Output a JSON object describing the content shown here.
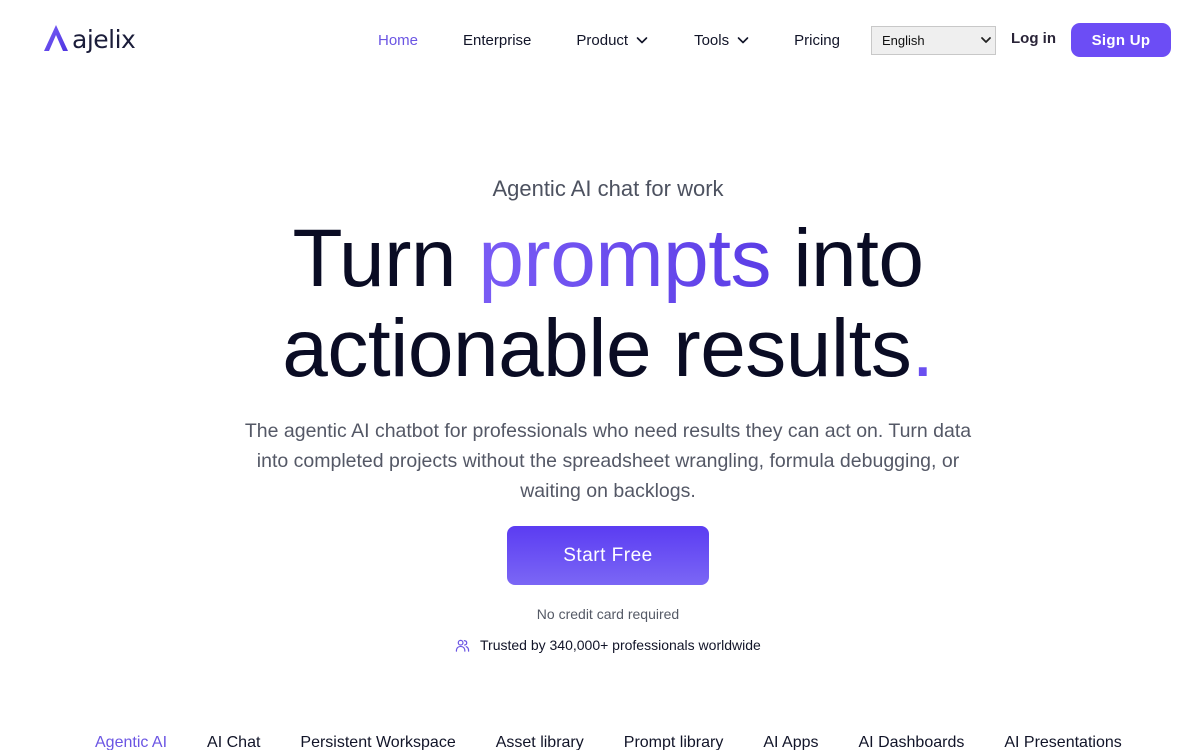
{
  "brand": {
    "name": "ajelix",
    "accent_color": "#6a4ff0",
    "logo_icon": "ajelix-logo-icon"
  },
  "nav": {
    "items": [
      {
        "label": "Home",
        "active": true,
        "has_dropdown": false
      },
      {
        "label": "Enterprise",
        "active": false,
        "has_dropdown": false
      },
      {
        "label": "Product",
        "active": false,
        "has_dropdown": true
      },
      {
        "label": "Tools",
        "active": false,
        "has_dropdown": true
      },
      {
        "label": "Pricing",
        "active": false,
        "has_dropdown": false
      }
    ],
    "language": {
      "selected": "English"
    },
    "login_label": "Log in",
    "signup_label": "Sign Up"
  },
  "hero": {
    "eyebrow": "Agentic AI chat for work",
    "headline": {
      "part1": "Turn ",
      "highlight": "prompts",
      "part2": " into",
      "line2": "actionable results",
      "dot": "."
    },
    "subtext": "The agentic AI chatbot for professionals who need results they can act on. Turn data into completed projects without the spreadsheet wrangling, formula debugging, or waiting on backlogs.",
    "cta_label": "Start Free",
    "note": "No credit card required",
    "trusted": "Trusted by 340,000+ professionals worldwide",
    "trusted_icon": "users-icon"
  },
  "feature_tabs": [
    {
      "label": "Agentic AI",
      "active": true
    },
    {
      "label": "AI Chat",
      "active": false
    },
    {
      "label": "Persistent Workspace",
      "active": false
    },
    {
      "label": "Asset library",
      "active": false
    },
    {
      "label": "Prompt library",
      "active": false
    },
    {
      "label": "AI Apps",
      "active": false
    },
    {
      "label": "AI Dashboards",
      "active": false
    },
    {
      "label": "AI Presentations",
      "active": false
    }
  ]
}
